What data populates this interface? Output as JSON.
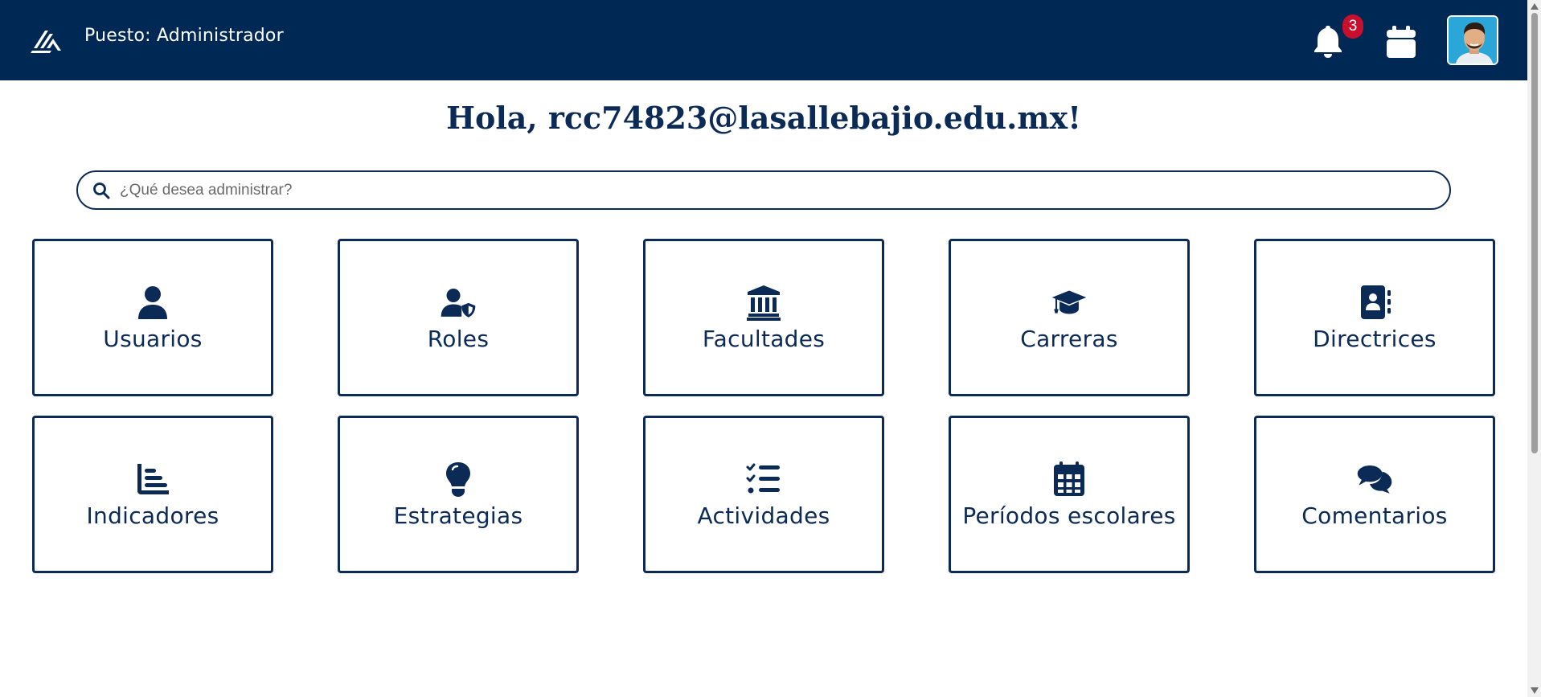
{
  "header": {
    "role_label": "Puesto: Administrador",
    "notification_count": "3"
  },
  "greeting": "Hola, rcc74823@lasallebajio.edu.mx!",
  "search": {
    "placeholder": "¿Qué desea administrar?",
    "value": ""
  },
  "cards": [
    {
      "label": "Usuarios",
      "icon": "user-icon"
    },
    {
      "label": "Roles",
      "icon": "user-shield-icon"
    },
    {
      "label": "Facultades",
      "icon": "building-columns-icon"
    },
    {
      "label": "Carreras",
      "icon": "graduation-cap-icon"
    },
    {
      "label": "Directrices",
      "icon": "address-book-icon"
    },
    {
      "label": "Indicadores",
      "icon": "chart-simple-icon"
    },
    {
      "label": "Estrategias",
      "icon": "lightbulb-icon"
    },
    {
      "label": "Actividades",
      "icon": "list-check-icon"
    },
    {
      "label": "Períodos escolares",
      "icon": "calendar-days-icon"
    },
    {
      "label": "Comentarios",
      "icon": "comments-icon"
    }
  ],
  "colors": {
    "primary": "#002855",
    "badge": "#c8102e",
    "text": "#0b2a56"
  }
}
